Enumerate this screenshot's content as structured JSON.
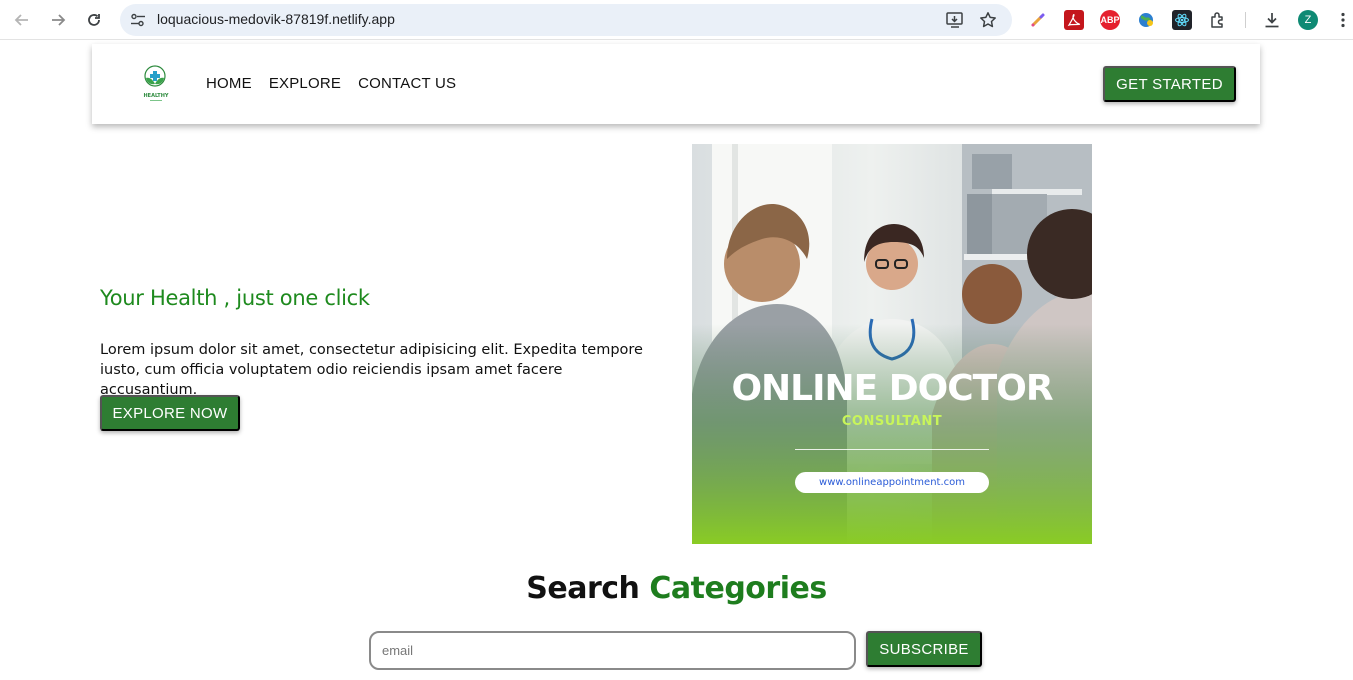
{
  "browser": {
    "url": "loquacious-medovik-87819f.netlify.app",
    "profile_initial": "Z",
    "icons": [
      "back-icon",
      "forward-icon",
      "reload-icon",
      "site-settings-icon",
      "install-app-icon",
      "bookmark-star-icon",
      "color-picker-extension-icon",
      "pdf-extension-icon",
      "adblock-extension-icon",
      "globe-extension-icon",
      "react-devtools-icon",
      "extensions-puzzle-icon",
      "download-icon",
      "menu-dots-icon"
    ],
    "adblock_label": "ABP"
  },
  "header": {
    "logo_text": "HEALTHY",
    "nav": [
      {
        "label": "HOME"
      },
      {
        "label": "EXPLORE"
      },
      {
        "label": "CONTACT US"
      }
    ],
    "cta_label": "GET STARTED"
  },
  "hero": {
    "title": "Your Health , just one click",
    "text": "Lorem ipsum dolor sit amet, consectetur adipisicing elit. Expedita tempore iusto, cum officia voluptatem odio reiciendis ipsam amet facere accusantium.",
    "button_label": "EXPLORE NOW",
    "image": {
      "headline": "ONLINE DOCTOR",
      "subheadline": "CONSULTANT",
      "url_text": "www.onlineappointment.com"
    }
  },
  "search": {
    "heading_part1": "Search",
    "heading_part2": "Categories",
    "input_placeholder": "email",
    "button_label": "SUBSCRIBE"
  },
  "colors": {
    "brand_green": "#2e7d32",
    "title_green": "#1e8a1e",
    "poster_lime": "#c8f55a"
  }
}
